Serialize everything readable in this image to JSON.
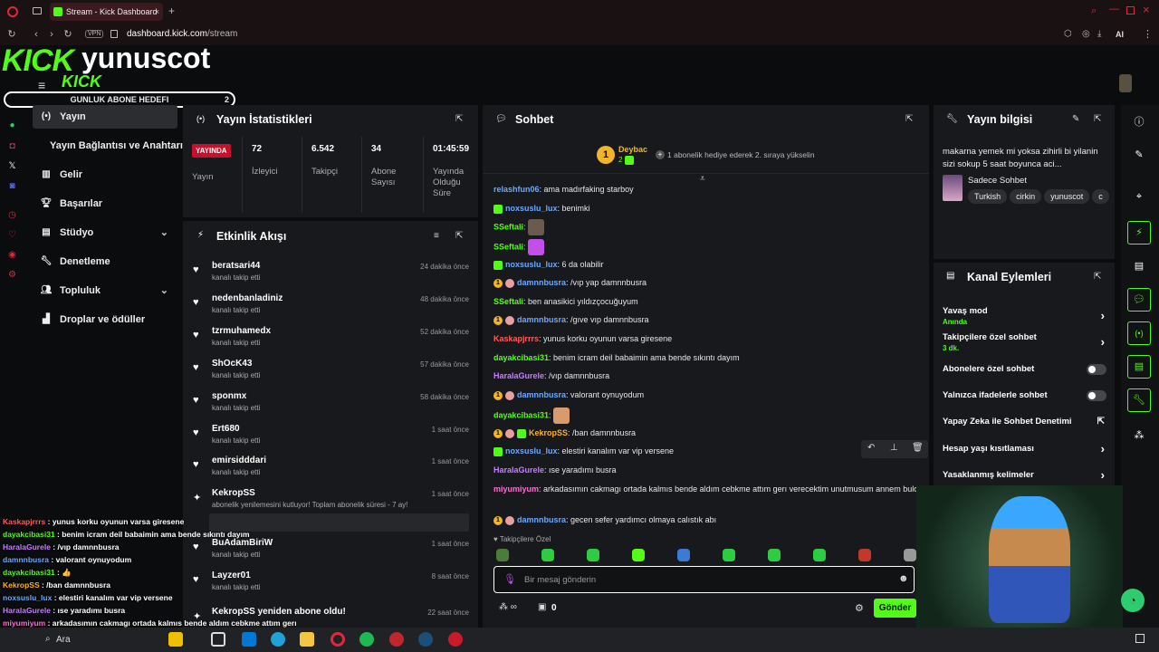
{
  "browser": {
    "tab_title": "Stream - Kick Dashboard",
    "vpn": "VPN",
    "url_domain": "dashboard.kick.com",
    "url_path": "/stream",
    "ai_label": "AI"
  },
  "overlay": {
    "logo": "KICK",
    "channel_name": "yunuscot",
    "logo_small": "KICK",
    "goal_label": "GUNLUK ABONE HEDEFI",
    "goal_count": "2",
    "chat": [
      {
        "user": "Kaskapjrrrs",
        "text": " : yunus korku oyunun varsa giresene",
        "color": "#ff5c5c"
      },
      {
        "user": "dayakcibasi31",
        "text": " : benim icram deil babaimin ama bende sıkıntı dayım",
        "color": "#53fc18"
      },
      {
        "user": "HaralaGurele",
        "text": " : /vıp damnnbusra",
        "color": "#c77dff"
      },
      {
        "user": "damnnbusra",
        "text": " : valorant oynuyodum",
        "color": "#6aa9ff"
      },
      {
        "user": "dayakcibasi31",
        "text": " : 👍",
        "color": "#53fc18"
      },
      {
        "user": "KekropSS",
        "text": " : /ban damnnbusra",
        "color": "#ffb020"
      },
      {
        "user": "noxsuslu_lux",
        "text": " : elestiri kanalım var vip versene",
        "color": "#6aa9ff"
      },
      {
        "user": "HaralaGurele",
        "text": " : ıse yaradımı busra",
        "color": "#c77dff"
      },
      {
        "user": "miyumiyum",
        "text": " : arkadasımın cakmagı ortada kalmıs bende aldım cebkme attım gerı",
        "color": "#ff6ad5"
      }
    ]
  },
  "sidebar": {
    "items": [
      {
        "label": "Yayın",
        "icon": "broadcast-icon"
      },
      {
        "label": "Yayın Bağlantısı ve Anahtarı",
        "icon": ""
      },
      {
        "label": "Gelir",
        "icon": "chart-icon"
      },
      {
        "label": "Başarılar",
        "icon": "trophy-icon"
      },
      {
        "label": "Stüdyo",
        "icon": "studio-icon"
      },
      {
        "label": "Denetleme",
        "icon": "wrench-icon"
      },
      {
        "label": "Topluluk",
        "icon": "people-icon"
      },
      {
        "label": "Droplar ve ödüller",
        "icon": "gift-icon"
      }
    ]
  },
  "stats": {
    "title": "Yayın İstatistikleri",
    "live_badge": "YAYINDA",
    "live_label": "Yayın",
    "cols": [
      {
        "value": "72",
        "label": "İzleyici"
      },
      {
        "value": "6.542",
        "label": "Takipçi"
      },
      {
        "value": "34",
        "label": "Abone Sayısı"
      },
      {
        "value": "01:45:59",
        "label": "Yayında Olduğu Süre"
      }
    ]
  },
  "activity": {
    "title": "Etkinlik Akışı",
    "events": [
      {
        "name": "beratsari44",
        "sub": "kanalı takip etti",
        "time": "24 dakika önce"
      },
      {
        "name": "nedenbanladiniz",
        "sub": "kanalı takip etti",
        "time": "48 dakika önce"
      },
      {
        "name": "tzrmuhamedx",
        "sub": "kanalı takip etti",
        "time": "52 dakika önce"
      },
      {
        "name": "ShOcK43",
        "sub": "kanalı takip etti",
        "time": "57 dakika önce"
      },
      {
        "name": "sponmx",
        "sub": "kanalı takip etti",
        "time": "58 dakika önce"
      },
      {
        "name": "Ert680",
        "sub": "kanalı takip etti",
        "time": "1 saat önce"
      },
      {
        "name": "emirsidddari",
        "sub": "kanalı takip etti",
        "time": "1 saat önce"
      },
      {
        "name": "KekropSS",
        "sub": "abonelik yenilemesini kutluyor! Toplam abonelik süresi - 7 ay!",
        "time": "1 saat önce"
      },
      {
        "name": "BuAdamBiriW",
        "sub": "kanalı takip etti",
        "time": "1 saat önce"
      },
      {
        "name": "Layzer01",
        "sub": "kanalı takip etti",
        "time": "8 saat önce"
      },
      {
        "name": "KekropSS yeniden abone oldu!",
        "sub": "",
        "time": "22 saat önce"
      }
    ]
  },
  "chat": {
    "title": "Sohbet",
    "pinned_user": "Deybac",
    "pinned_count": "2",
    "pinned_text": "1 abonelik hediye ederek 2. sıraya yükselin",
    "messages": [
      {
        "user": "relashfun06",
        "text": ": ama madırfaking starboy",
        "color": "#6aa9ff",
        "badges": []
      },
      {
        "user": "noxsuslu_lux",
        "text": ": benimki",
        "color": "#6aa9ff",
        "badges": [
          "sub"
        ]
      },
      {
        "user": "SSeftali",
        "text": ":",
        "color": "#53fc18",
        "badges": [],
        "emote": "#6b5a4e"
      },
      {
        "user": "SSeftali",
        "text": ":",
        "color": "#53fc18",
        "badges": [],
        "emote": "#c44ee8"
      },
      {
        "user": "noxsuslu_lux",
        "text": ": 6 da olabilir",
        "color": "#6aa9ff",
        "badges": [
          "sub"
        ]
      },
      {
        "user": "damnnbusra",
        "text": ": /vıp yap damnnbusra",
        "color": "#6aa9ff",
        "badges": [
          "gold",
          "pig"
        ]
      },
      {
        "user": "SSeftali",
        "text": ": ben anasikici yıldızçocuğuyum",
        "color": "#53fc18",
        "badges": []
      },
      {
        "user": "damnnbusra",
        "text": ": /gıve vıp damnnbusra",
        "color": "#6aa9ff",
        "badges": [
          "gold",
          "pig"
        ]
      },
      {
        "user": "Kaskapjrrrs",
        "text": ": yunus korku oyunun varsa giresene",
        "color": "#ff5c5c",
        "badges": []
      },
      {
        "user": "dayakcibasi31",
        "text": ": benim icram deil babaimin ama bende sıkıntı dayım",
        "color": "#53fc18",
        "badges": []
      },
      {
        "user": "HaralaGurele",
        "text": ": /vıp damnnbusra",
        "color": "#c77dff",
        "badges": []
      },
      {
        "user": "damnnbusra",
        "text": ": valorant oynuyodum",
        "color": "#6aa9ff",
        "badges": [
          "gold",
          "pig"
        ]
      },
      {
        "user": "dayakcibasi31",
        "text": ":",
        "color": "#53fc18",
        "badges": [],
        "emote": "#d99a6c"
      },
      {
        "user": "KekropSS",
        "text": ": /ban damnnbusra",
        "color": "#ffb020",
        "badges": [
          "gold",
          "pig",
          "sub"
        ]
      },
      {
        "user": "noxsuslu_lux",
        "text": ": elestiri kanalım var vip versene",
        "color": "#6aa9ff",
        "badges": [
          "sub"
        ]
      },
      {
        "user": "HaralaGurele",
        "text": ": ıse yaradımı busra",
        "color": "#c77dff",
        "badges": []
      },
      {
        "user": "miyumiyum",
        "text": ": arkadasımın cakmagı ortada kalmıs bende aldım cebkme attım gerı verecektim unutmusum annem buldu",
        "color": "#ff6ad5",
        "badges": []
      },
      {
        "user": "damnnbusra",
        "text": ": gecen sefer yardımcı olmaya calıstık abı",
        "color": "#6aa9ff",
        "badges": [
          "gold",
          "pig"
        ]
      }
    ],
    "followers_only": "Takipçilere Özel",
    "input_placeholder": "Bir mesaj gönderin",
    "points": "0",
    "send": "Gönder"
  },
  "info": {
    "title": "Yayın bilgisi",
    "stream_title": "makarna yemek mi yoksa zihirli bi yilanin sizi sokup 5 saat boyunca aci...",
    "category": "Sadece Sohbet",
    "tags": [
      "Turkish",
      "cirkin",
      "yunuscot",
      "c"
    ]
  },
  "actions": {
    "title": "Kanal Eylemleri",
    "items": [
      {
        "label": "Yavaş mod",
        "sub": "Anında",
        "ctrl": "arrow"
      },
      {
        "label": "Takipçilere özel sohbet",
        "sub": "3 dk.",
        "ctrl": "arrow"
      },
      {
        "label": "Abonelere özel sohbet",
        "sub": "",
        "ctrl": "toggle"
      },
      {
        "label": "Yalnızca ifadelerle sohbet",
        "sub": "",
        "ctrl": "toggle"
      },
      {
        "label": "Yapay Zeka ile Sohbet Denetimi",
        "sub": "",
        "ctrl": "ext"
      },
      {
        "label": "Hesap yaşı kısıtlaması",
        "sub": "",
        "ctrl": "arrow"
      },
      {
        "label": "Yasaklanmış kelimeler",
        "sub": "",
        "ctrl": "arrow"
      }
    ]
  },
  "taskbar": {
    "search": "Ara"
  },
  "colors": {
    "accent": "#53fc18",
    "live": "#c8102e",
    "panel": "#18191d"
  }
}
